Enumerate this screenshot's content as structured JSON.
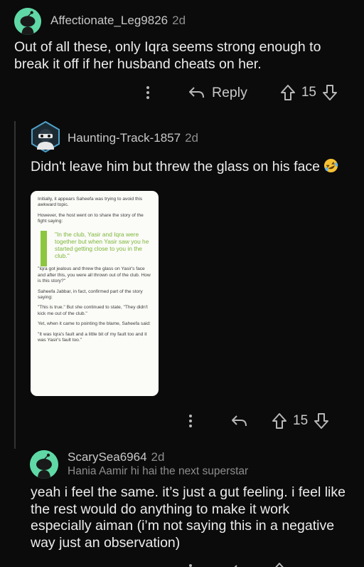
{
  "comments": [
    {
      "username": "Affectionate_Leg9826",
      "age": "2d",
      "body": "Out of all these, only Iqra seems strong enough to break it off if her husband cheats on her.",
      "reply_label": "Reply",
      "votes": "15"
    },
    {
      "username": "Haunting-Track-1857",
      "age": "2d",
      "body": "Didn't leave him but threw the glass on his face",
      "emoji": "rolling-on-floor-laughing",
      "votes": "15",
      "image": {
        "paragraphs_before": [
          "Initially, it appears Saheefa was trying to avoid this awkward topic.",
          "However, the host went on to share the story of the fight saying:"
        ],
        "pull_quote": "\"In the club, Yasir and Iqra were together but when Yasir saw you he started getting close to you in the club.\"",
        "paragraphs_after": [
          "\"Iqra got jealous and threw the glass on Yasir's face and after this, you were all thrown out of the club. How is this story?\"",
          "Saheefa Jabbar, in fact, confirmed part of the story saying:",
          "\"This is true.\" But she continued to state, \"They didn't kick me out of the club.\"",
          "Yet, when it came to pointing the blame, Saheefa said:",
          "\"It was Iqra's fault and a little bit of my fault too and it was Yasir's fault too.\""
        ]
      }
    },
    {
      "username": "ScarySea6964",
      "age": "2d",
      "flair": "Hania Aamir hi hai the next superstar",
      "body": "yeah i feel the same. it’s just a gut feeling. i feel like the rest would do anything to make it work especially aiman (i’m not saying this in a negative way just an observation)"
    }
  ],
  "colors": {
    "background": "#0b0b0b",
    "avatar": "#5fd8a6",
    "pull_quote_green": "#8cc63f"
  }
}
